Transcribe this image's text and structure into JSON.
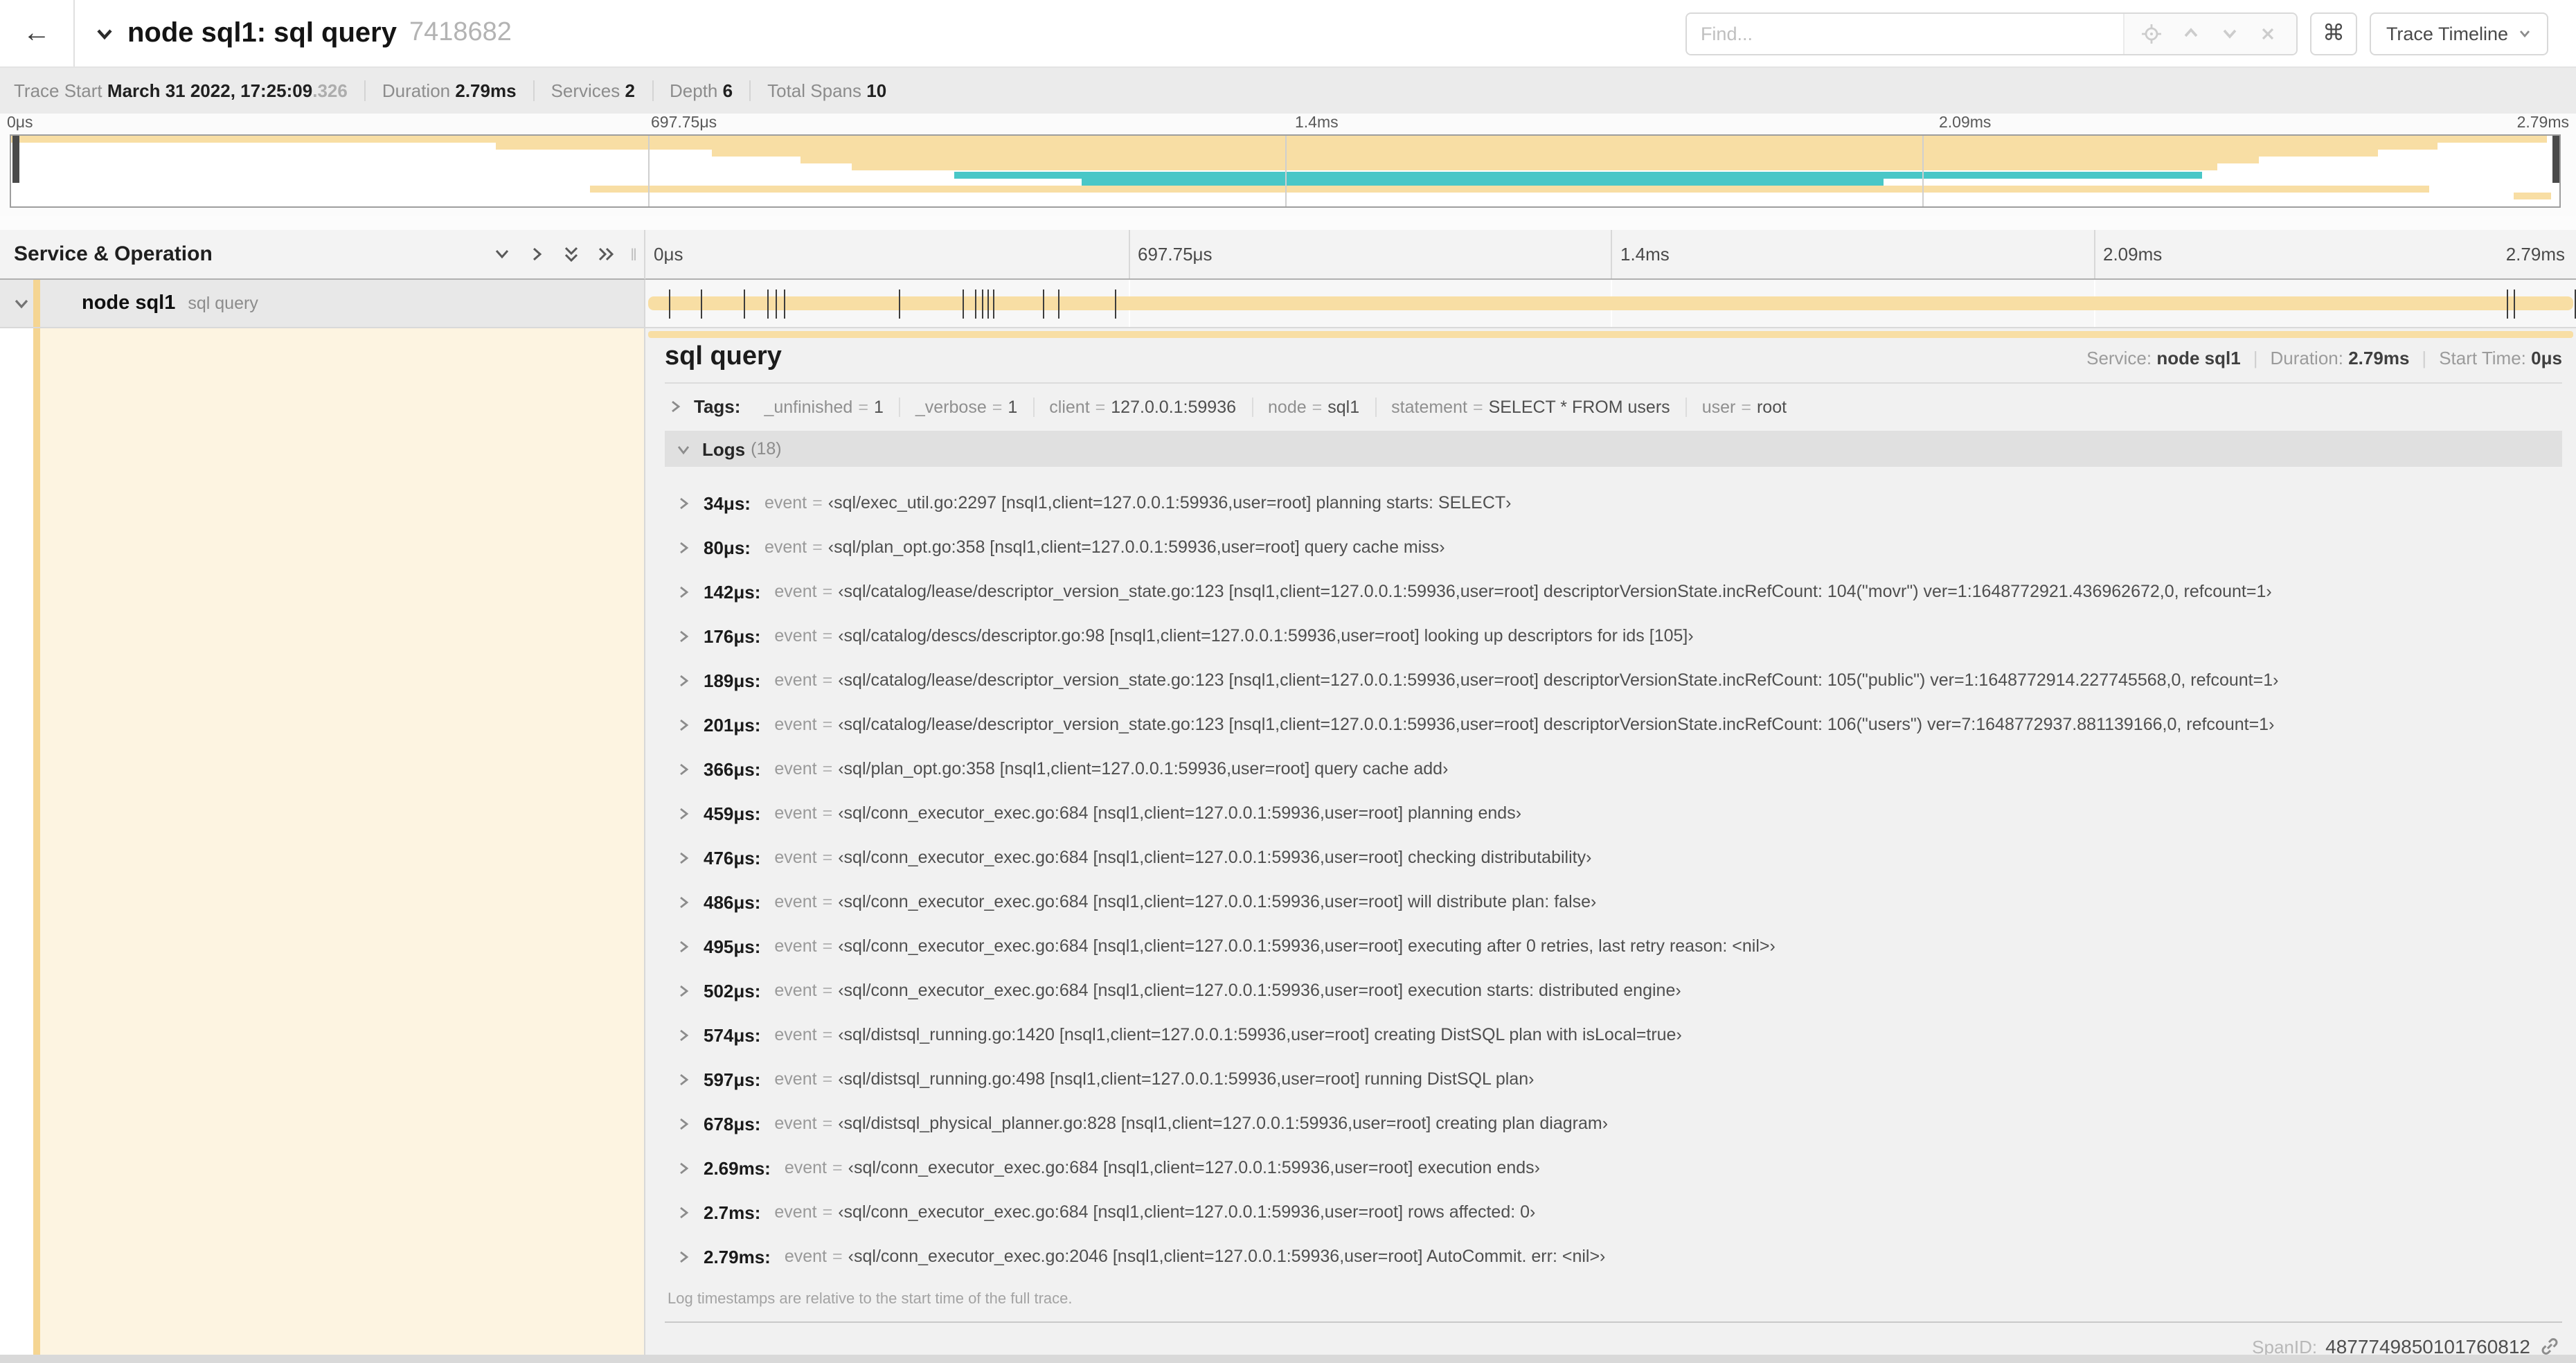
{
  "header": {
    "back": "←",
    "title": "node sql1: sql query",
    "trace_id": "7418682",
    "find_placeholder": "Find...",
    "shortcut_key": "⌘",
    "view_selector": "Trace Timeline"
  },
  "trace_meta": {
    "items": [
      {
        "label": "Trace Start",
        "value": "March 31 2022, 17:25:09",
        "suffix": ".326"
      },
      {
        "label": "Duration",
        "value": "2.79ms",
        "suffix": ""
      },
      {
        "label": "Services",
        "value": "2",
        "suffix": ""
      },
      {
        "label": "Depth",
        "value": "6",
        "suffix": ""
      },
      {
        "label": "Total Spans",
        "value": "10",
        "suffix": ""
      }
    ]
  },
  "timeline": {
    "tick_labels": [
      "0μs",
      "697.75μs",
      "1.4ms",
      "2.09ms",
      "2.79ms"
    ]
  },
  "minimap": {
    "colors": {
      "tan": "#f8dea4",
      "teal": "#49c7c7"
    },
    "spans": [
      {
        "row": 0,
        "start": 0,
        "end": 99.5,
        "color": "tan"
      },
      {
        "row": 1,
        "start": 19,
        "end": 95.2,
        "color": "tan"
      },
      {
        "row": 2,
        "start": 27.5,
        "end": 92.9,
        "color": "tan"
      },
      {
        "row": 3,
        "start": 31,
        "end": 88.2,
        "color": "tan"
      },
      {
        "row": 4,
        "start": 33,
        "end": 86.6,
        "color": "tan"
      },
      {
        "row": 5,
        "start": 37,
        "end": 86,
        "color": "teal"
      },
      {
        "row": 6,
        "start": 42,
        "end": 73.5,
        "color": "teal"
      },
      {
        "row": 7,
        "start": 22.7,
        "end": 94.9,
        "color": "tan"
      },
      {
        "row": 8,
        "start": 98.2,
        "end": 99.7,
        "color": "tan"
      }
    ]
  },
  "sidebar": {
    "title": "Service & Operation",
    "row": {
      "service": "node sql1",
      "operation": "sql query"
    }
  },
  "span_bar": {
    "tick_percents": [
      1.22,
      2.87,
      5.09,
      6.31,
      6.77,
      7.2,
      13.12,
      16.45,
      17.06,
      17.42,
      17.74,
      17.99,
      20.57,
      21.4,
      24.3,
      96.42,
      96.77,
      99.9
    ]
  },
  "detail": {
    "title": "sql query",
    "meta": [
      {
        "label": "Service:",
        "value": "node sql1"
      },
      {
        "label": "Duration:",
        "value": "2.79ms"
      },
      {
        "label": "Start Time:",
        "value": "0μs"
      }
    ],
    "tags_label": "Tags:",
    "tags": [
      {
        "key": "_unfinished",
        "value": "1"
      },
      {
        "key": "_verbose",
        "value": "1"
      },
      {
        "key": "client",
        "value": "127.0.0.1:59936"
      },
      {
        "key": "node",
        "value": "sql1"
      },
      {
        "key": "statement",
        "value": "SELECT * FROM users"
      },
      {
        "key": "user",
        "value": "root"
      }
    ],
    "logs_label": "Logs",
    "logs_count": "(18)",
    "log_key": "event",
    "logs": [
      {
        "t": "34μs:",
        "v": "‹sql/exec_util.go:2297 [nsql1,client=127.0.0.1:59936,user=root] planning starts: SELECT›"
      },
      {
        "t": "80μs:",
        "v": "‹sql/plan_opt.go:358 [nsql1,client=127.0.0.1:59936,user=root] query cache miss›"
      },
      {
        "t": "142μs:",
        "v": "‹sql/catalog/lease/descriptor_version_state.go:123 [nsql1,client=127.0.0.1:59936,user=root] descriptorVersionState.incRefCount: 104(\"movr\") ver=1:1648772921.436962672,0, refcount=1›"
      },
      {
        "t": "176μs:",
        "v": "‹sql/catalog/descs/descriptor.go:98 [nsql1,client=127.0.0.1:59936,user=root] looking up descriptors for ids [105]›"
      },
      {
        "t": "189μs:",
        "v": "‹sql/catalog/lease/descriptor_version_state.go:123 [nsql1,client=127.0.0.1:59936,user=root] descriptorVersionState.incRefCount: 105(\"public\") ver=1:1648772914.227745568,0, refcount=1›"
      },
      {
        "t": "201μs:",
        "v": "‹sql/catalog/lease/descriptor_version_state.go:123 [nsql1,client=127.0.0.1:59936,user=root] descriptorVersionState.incRefCount: 106(\"users\") ver=7:1648772937.881139166,0, refcount=1›"
      },
      {
        "t": "366μs:",
        "v": "‹sql/plan_opt.go:358 [nsql1,client=127.0.0.1:59936,user=root] query cache add›"
      },
      {
        "t": "459μs:",
        "v": "‹sql/conn_executor_exec.go:684 [nsql1,client=127.0.0.1:59936,user=root] planning ends›"
      },
      {
        "t": "476μs:",
        "v": "‹sql/conn_executor_exec.go:684 [nsql1,client=127.0.0.1:59936,user=root] checking distributability›"
      },
      {
        "t": "486μs:",
        "v": "‹sql/conn_executor_exec.go:684 [nsql1,client=127.0.0.1:59936,user=root] will distribute plan: false›"
      },
      {
        "t": "495μs:",
        "v": "‹sql/conn_executor_exec.go:684 [nsql1,client=127.0.0.1:59936,user=root] executing after 0 retries, last retry reason: <nil>›"
      },
      {
        "t": "502μs:",
        "v": "‹sql/conn_executor_exec.go:684 [nsql1,client=127.0.0.1:59936,user=root] execution starts: distributed engine›"
      },
      {
        "t": "574μs:",
        "v": "‹sql/distsql_running.go:1420 [nsql1,client=127.0.0.1:59936,user=root] creating DistSQL plan with isLocal=true›"
      },
      {
        "t": "597μs:",
        "v": "‹sql/distsql_running.go:498 [nsql1,client=127.0.0.1:59936,user=root] running DistSQL plan›"
      },
      {
        "t": "678μs:",
        "v": "‹sql/distsql_physical_planner.go:828 [nsql1,client=127.0.0.1:59936,user=root] creating plan diagram›"
      },
      {
        "t": "2.69ms:",
        "v": "‹sql/conn_executor_exec.go:684 [nsql1,client=127.0.0.1:59936,user=root] execution ends›"
      },
      {
        "t": "2.7ms:",
        "v": "‹sql/conn_executor_exec.go:684 [nsql1,client=127.0.0.1:59936,user=root] rows affected: 0›"
      },
      {
        "t": "2.79ms:",
        "v": "‹sql/conn_executor_exec.go:2046 [nsql1,client=127.0.0.1:59936,user=root] AutoCommit. err: <nil>›"
      }
    ],
    "note": "Log timestamps are relative to the start time of the full trace.",
    "spanid_label": "SpanID:",
    "spanid": "4877749850101760812"
  }
}
